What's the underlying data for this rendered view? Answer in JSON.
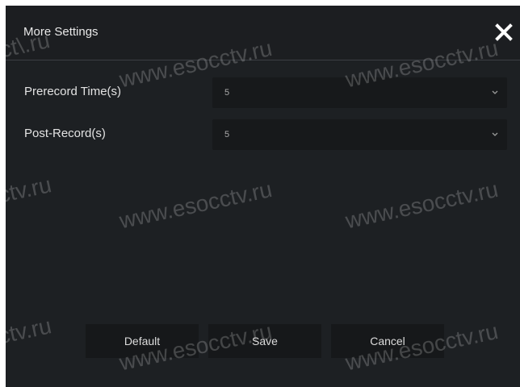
{
  "dialog": {
    "title": "More Settings",
    "close_icon": "close-icon"
  },
  "fields": [
    {
      "label": "Prerecord Time(s)",
      "value": "5"
    },
    {
      "label": "Post-Record(s)",
      "value": "5"
    }
  ],
  "buttons": {
    "default_label": "Default",
    "save_label": "Save",
    "cancel_label": "Cancel"
  },
  "watermark": {
    "full": "www.esocctv.ru",
    "partial_left": "ctv.ru",
    "partial_top": "ct\\.ru"
  },
  "colors": {
    "dialog_bg": "#1d2023",
    "field_bg": "#17191b",
    "button_bg": "#16181a",
    "text": "#e3e3e3"
  }
}
